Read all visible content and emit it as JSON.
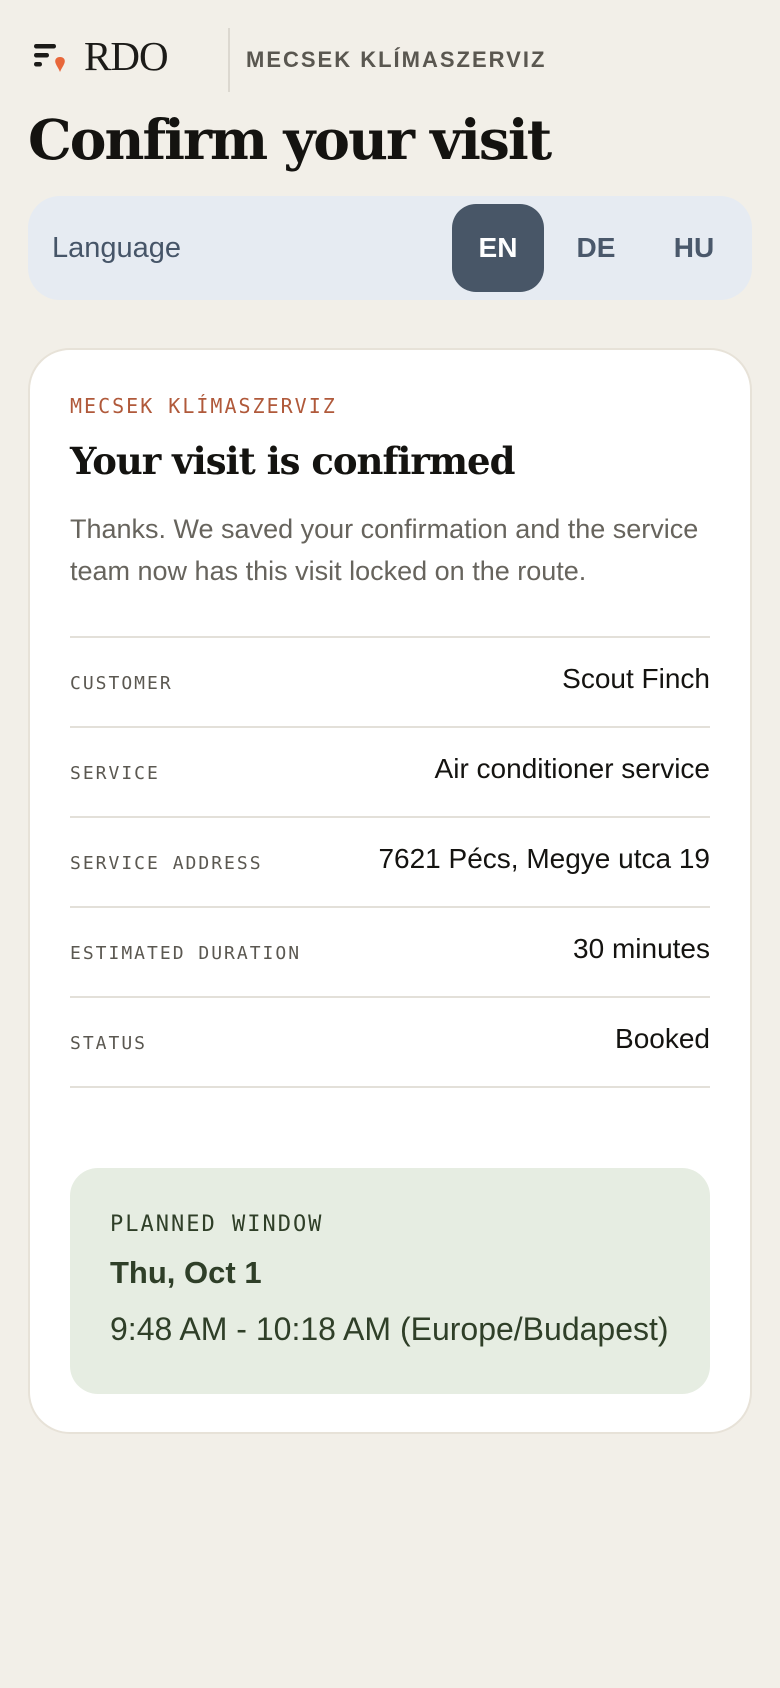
{
  "header": {
    "logo_icon": "rdo-logo-icon",
    "brand": "RDO",
    "company": "MECSEK KLÍMASZERVIZ"
  },
  "page_title": "Confirm your visit",
  "language": {
    "label": "Language",
    "options": [
      "EN",
      "DE",
      "HU"
    ],
    "selected": "EN"
  },
  "card": {
    "eyebrow": "MECSEK KLÍMASZERVIZ",
    "title": "Your visit is confirmed",
    "text": "Thanks. We saved your confirmation and the service team now has this visit locked on the route.",
    "rows": [
      {
        "label": "CUSTOMER",
        "value": "Scout Finch"
      },
      {
        "label": "SERVICE",
        "value": "Air conditioner service"
      },
      {
        "label": "SERVICE ADDRESS",
        "value": "7621 Pécs, Megye utca 19"
      },
      {
        "label": "ESTIMATED DURATION",
        "value": "30 minutes"
      },
      {
        "label": "STATUS",
        "value": "Booked"
      }
    ],
    "window": {
      "label": "PLANNED WINDOW",
      "date": "Thu, Oct 1",
      "time": "9:48 AM - 10:18 AM (Europe/Budapest)"
    }
  },
  "colors": {
    "background": "#f2efe8",
    "accent": "#e8673a",
    "language_active": "#485667",
    "window_background": "#e6ede2"
  }
}
